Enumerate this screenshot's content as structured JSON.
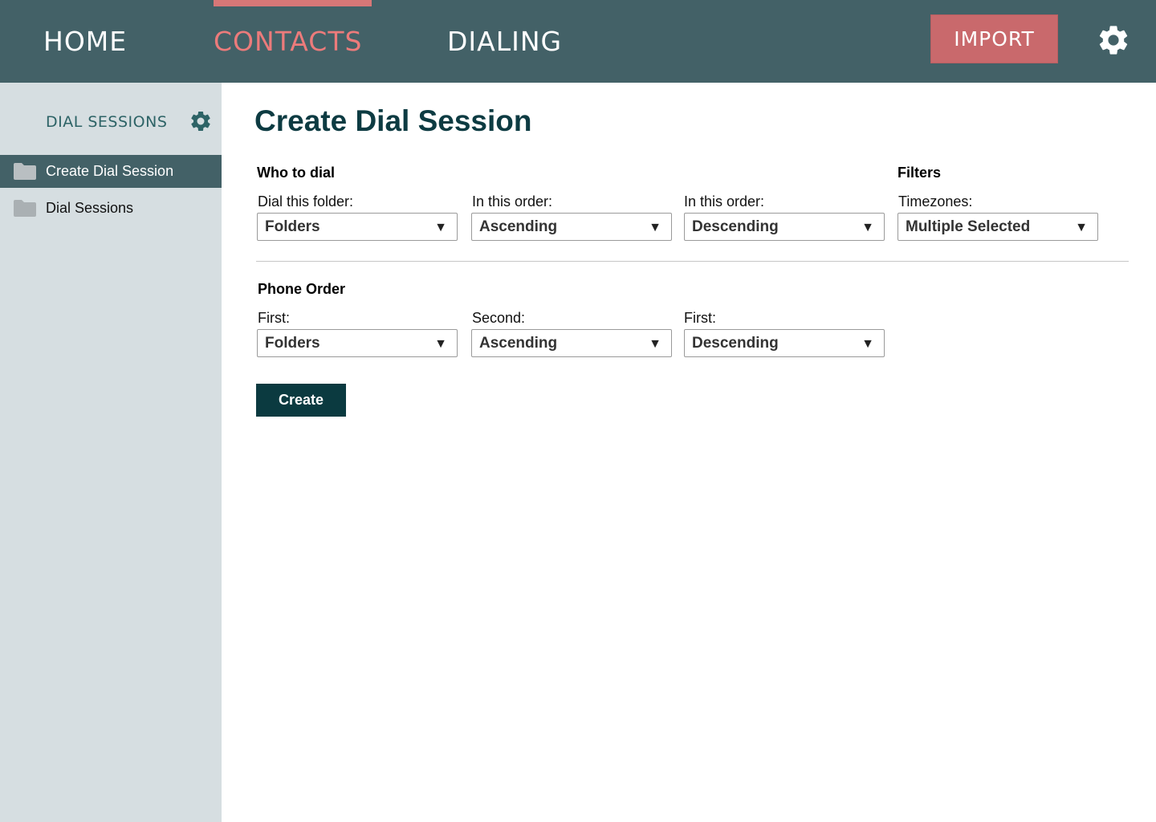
{
  "nav": {
    "home": "HOME",
    "contacts": "CONTACTS",
    "dialing": "DIALING",
    "import": "IMPORT",
    "active": "CONTACTS"
  },
  "sidebar": {
    "title": "DIAL SESSIONS",
    "items": [
      {
        "label": "Create Dial Session",
        "icon": "folder-icon",
        "active": true
      },
      {
        "label": "Dial Sessions",
        "icon": "folder-icon",
        "active": false
      }
    ]
  },
  "main": {
    "title": "Create Dial Session",
    "who_to_dial": {
      "heading": "Who to dial",
      "fields": [
        {
          "label": "Dial this folder:",
          "value": "Folders"
        },
        {
          "label": "In this order:",
          "value": "Ascending"
        },
        {
          "label": "In this order:",
          "value": "Descending"
        }
      ]
    },
    "filters": {
      "heading": "Filters",
      "fields": [
        {
          "label": "Timezones:",
          "value": "Multiple Selected"
        }
      ]
    },
    "phone_order": {
      "heading": "Phone Order",
      "fields": [
        {
          "label": "First:",
          "value": "Folders"
        },
        {
          "label": "Second:",
          "value": "Ascending"
        },
        {
          "label": "First:",
          "value": "Descending"
        }
      ]
    },
    "create_label": "Create"
  },
  "colors": {
    "topbar": "#436167",
    "accent": "#ec7b7b",
    "import_button": "#c9696c",
    "sidebar": "#d6dee1",
    "primary_dark": "#0b3a40"
  }
}
